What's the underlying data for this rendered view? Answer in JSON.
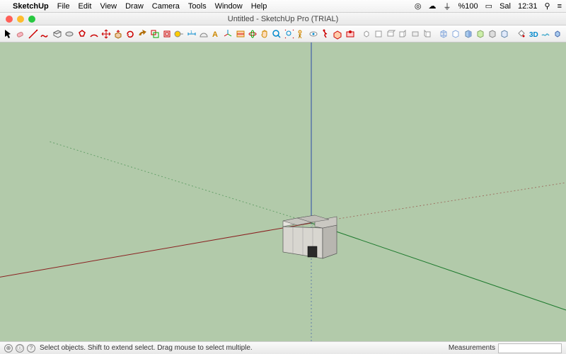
{
  "menubar": {
    "app": "SketchUp",
    "items": [
      "File",
      "Edit",
      "View",
      "Draw",
      "Camera",
      "Tools",
      "Window",
      "Help"
    ],
    "right": {
      "battery": "%100",
      "wifi": "􀙇",
      "day": "Sal",
      "time": "12:31"
    }
  },
  "window": {
    "title": "Untitled - SketchUp Pro (TRIAL)"
  },
  "toolbar": {
    "tools": [
      {
        "name": "select",
        "color": "#000"
      },
      {
        "name": "eraser",
        "color": "#e88"
      },
      {
        "name": "line",
        "color": "#c00"
      },
      {
        "name": "freehand",
        "color": "#c00"
      },
      {
        "name": "rectangle",
        "color": "#888"
      },
      {
        "name": "circle",
        "color": "#888"
      },
      {
        "name": "polygon",
        "color": "#c00"
      },
      {
        "name": "arc",
        "color": "#c00"
      },
      {
        "name": "move",
        "color": "#c00"
      },
      {
        "name": "pushpull",
        "color": "#c80"
      },
      {
        "name": "rotate",
        "color": "#c00"
      },
      {
        "name": "followme",
        "color": "#c80"
      },
      {
        "name": "scale",
        "color": "#c00"
      },
      {
        "name": "offset",
        "color": "#c00"
      },
      {
        "name": "tape",
        "color": "#888"
      },
      {
        "name": "dimension",
        "color": "#08c"
      },
      {
        "name": "protractor",
        "color": "#888"
      },
      {
        "name": "text",
        "color": "#c80"
      },
      {
        "name": "axes",
        "color": "#08c"
      },
      {
        "name": "section",
        "color": "#c80"
      },
      {
        "name": "orbit",
        "color": "#c00"
      },
      {
        "name": "pan",
        "color": "#c00"
      },
      {
        "name": "zoom",
        "color": "#08c"
      },
      {
        "name": "zoomextents",
        "color": "#08c"
      },
      {
        "name": "position",
        "color": "#c80"
      },
      {
        "name": "lookaround",
        "color": "#c80"
      },
      {
        "name": "walk",
        "color": "#c00"
      },
      {
        "name": "3dwarehouse",
        "color": "#c00"
      },
      {
        "name": "extwhse",
        "color": "#c00"
      }
    ],
    "views": [
      "iso",
      "top",
      "front",
      "right",
      "back",
      "left"
    ],
    "styles": [
      "wire",
      "hidden",
      "shaded",
      "shadedtex",
      "mono",
      "xray"
    ],
    "extras": [
      "paint",
      "3dtext",
      "sandbox",
      "components"
    ]
  },
  "status": {
    "hint": "Select objects. Shift to extend select. Drag mouse to select multiple.",
    "meas_label": "Measurements",
    "meas_value": ""
  }
}
